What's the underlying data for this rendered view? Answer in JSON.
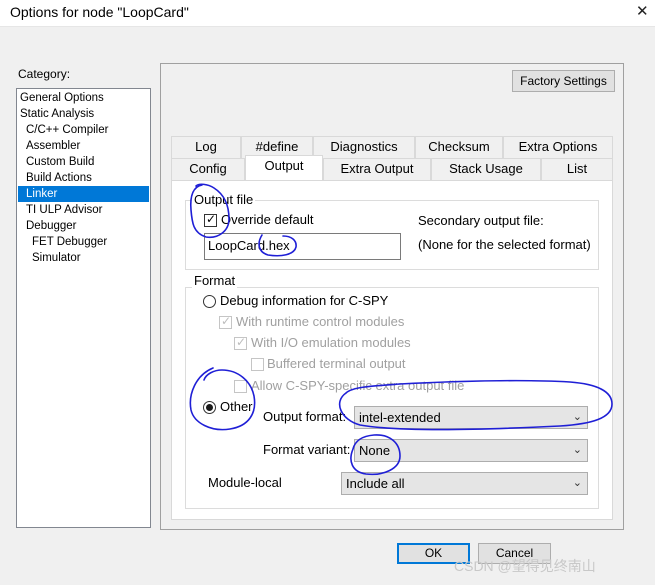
{
  "window": {
    "title": "Options for node \"LoopCard\"",
    "close_glyph": "✕"
  },
  "category": {
    "label": "Category:",
    "items": [
      {
        "label": "General Options"
      },
      {
        "label": "Static Analysis"
      },
      {
        "label": "C/C++ Compiler"
      },
      {
        "label": "Assembler"
      },
      {
        "label": "Custom Build"
      },
      {
        "label": "Build Actions"
      },
      {
        "label": "Linker"
      },
      {
        "label": "TI ULP Advisor"
      },
      {
        "label": "Debugger"
      },
      {
        "label": "FET Debugger"
      },
      {
        "label": "Simulator"
      }
    ],
    "selected": "Linker"
  },
  "factory_settings_label": "Factory Settings",
  "tabs_top": [
    "Log",
    "#define",
    "Diagnostics",
    "Checksum",
    "Extra Options"
  ],
  "tabs_bottom": [
    "Config",
    "Output",
    "Extra Output",
    "Stack Usage",
    "List"
  ],
  "active_tab": "Output",
  "output_file": {
    "group_label": "Output file",
    "override_label": "Override default",
    "override_checked": true,
    "filename": "LoopCard.hex",
    "secondary_label": "Secondary output file:",
    "secondary_value": "(None for the selected format)"
  },
  "format": {
    "group_label": "Format",
    "debug_info_label": "Debug information for C-SPY",
    "runtime_label": "With runtime control modules",
    "io_label": "With I/O emulation modules",
    "buffered_label": "Buffered terminal output",
    "allow_label": "Allow C-SPY-specific extra output file",
    "other_label": "Other",
    "selected_radio": "Other",
    "output_format_label": "Output format:",
    "output_format_value": "intel-extended",
    "format_variant_label": "Format variant:",
    "format_variant_value": "None",
    "module_local_label": "Module-local",
    "module_local_value": "Include all"
  },
  "buttons": {
    "ok": "OK",
    "cancel": "Cancel"
  },
  "watermark": "CSDN @望得见终南山",
  "annotation_color": "#1f1fd6"
}
